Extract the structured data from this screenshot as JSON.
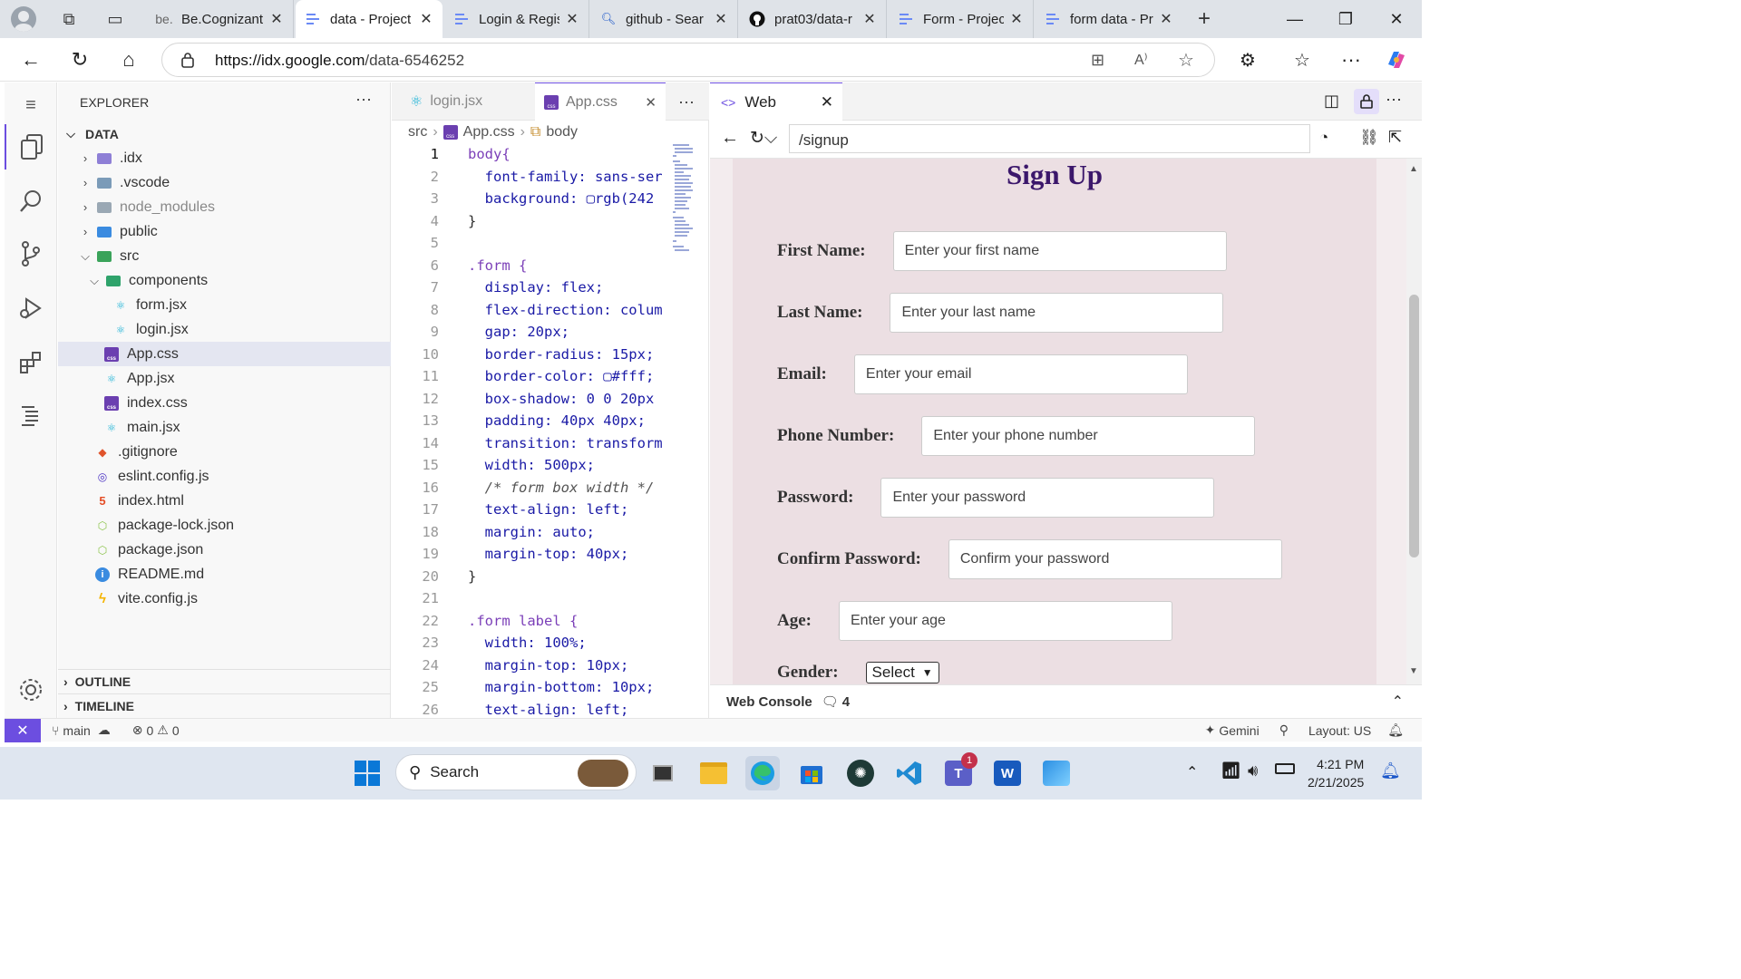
{
  "browser": {
    "tabs": [
      {
        "label": "Be.Cognizant",
        "favicon": "be.",
        "active": false
      },
      {
        "label": "data - Project",
        "favicon": "idx",
        "active": true
      },
      {
        "label": "Login & Regis",
        "favicon": "idx",
        "active": false
      },
      {
        "label": "github - Sear",
        "favicon": "search",
        "active": false
      },
      {
        "label": "prat03/data-r",
        "favicon": "github",
        "active": false
      },
      {
        "label": "Form - Projec",
        "favicon": "idx",
        "active": false
      },
      {
        "label": "form data - Pr",
        "favicon": "idx",
        "active": false
      }
    ],
    "url_host": "https://idx.google.com",
    "url_path": "/data-6546252"
  },
  "explorer": {
    "title": "EXPLORER",
    "root": "DATA",
    "items": [
      ".idx",
      ".vscode",
      "node_modules",
      "public",
      "src",
      "components",
      "form.jsx",
      "login.jsx",
      "App.css",
      "App.jsx",
      "index.css",
      "main.jsx",
      ".gitignore",
      "eslint.config.js",
      "index.html",
      "package-lock.json",
      "package.json",
      "README.md",
      "vite.config.js"
    ],
    "outline": "OUTLINE",
    "timeline": "TIMELINE"
  },
  "editor": {
    "tabs": [
      "login.jsx",
      "App.css"
    ],
    "crumb": [
      "src",
      "App.css",
      "body"
    ],
    "lines": [
      "body{",
      "  font-family: sans-ser",
      "  background: ▢rgb(242",
      "}",
      "",
      ".form {",
      "  display: flex;",
      "  flex-direction: colum",
      "  gap: 20px;",
      "  border-radius: 15px;",
      "  border-color: ▢#fff;",
      "  box-shadow: 0 0 20px",
      "  padding: 40px 40px;",
      "  transition: transform",
      "  width: 500px;",
      "  /* form box width */",
      "  text-align: left;",
      "  margin: auto;",
      "  margin-top: 40px;",
      "}",
      "",
      ".form label {",
      "  width: 100%;",
      "  margin-top: 10px;",
      "  margin-bottom: 10px;",
      "  text-align: left;"
    ]
  },
  "web": {
    "tab": "Web",
    "path": "/signup",
    "title": "Sign Up",
    "fields": [
      {
        "label": "First Name:",
        "placeholder": "Enter your first name"
      },
      {
        "label": "Last Name:",
        "placeholder": "Enter your last name"
      },
      {
        "label": "Email:",
        "placeholder": "Enter your email"
      },
      {
        "label": "Phone Number:",
        "placeholder": "Enter your phone number"
      },
      {
        "label": "Password:",
        "placeholder": "Enter your password"
      },
      {
        "label": "Confirm Password:",
        "placeholder": "Confirm your password"
      },
      {
        "label": "Age:",
        "placeholder": "Enter your age"
      }
    ],
    "gender_label": "Gender:",
    "gender_value": "Select",
    "console": "Web Console",
    "console_count": "4"
  },
  "status": {
    "branch": "main",
    "errors": "0",
    "warnings": "0",
    "gemini": "Gemini",
    "layout": "Layout: US"
  },
  "taskbar": {
    "search": "Search",
    "time": "4:21 PM",
    "date": "2/21/2025",
    "teams_badge": "1"
  },
  "colors": {
    "accent": "#6c4ee0",
    "form_title": "#3b176b",
    "form_bg": "#ecdfe3"
  }
}
